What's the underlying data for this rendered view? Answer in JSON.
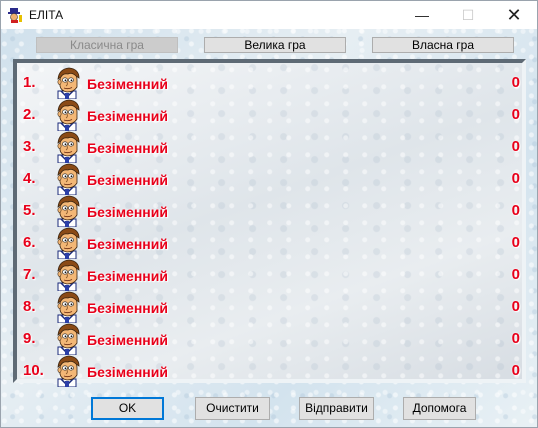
{
  "window": {
    "title": "ЕЛІТА",
    "minimize_glyph": "—",
    "maximize_glyph": "☐",
    "close_glyph": "✕"
  },
  "tabs": [
    {
      "label": "Класична гра",
      "enabled": false
    },
    {
      "label": "Велика гра",
      "enabled": true
    },
    {
      "label": "Власна гра",
      "enabled": true
    }
  ],
  "scores": [
    {
      "rank": "1.",
      "name": "Безіменний",
      "score": "0"
    },
    {
      "rank": "2.",
      "name": "Безіменний",
      "score": "0"
    },
    {
      "rank": "3.",
      "name": "Безіменний",
      "score": "0"
    },
    {
      "rank": "4.",
      "name": "Безіменний",
      "score": "0"
    },
    {
      "rank": "5.",
      "name": "Безіменний",
      "score": "0"
    },
    {
      "rank": "6.",
      "name": "Безіменний",
      "score": "0"
    },
    {
      "rank": "7.",
      "name": "Безіменний",
      "score": "0"
    },
    {
      "rank": "8.",
      "name": "Безіменний",
      "score": "0"
    },
    {
      "rank": "9.",
      "name": "Безіменний",
      "score": "0"
    },
    {
      "rank": "10.",
      "name": "Безіменний",
      "score": "0"
    }
  ],
  "buttons": {
    "ok": "OK",
    "clear": "Очистити",
    "send": "Відправити",
    "help": "Допомога"
  },
  "colors": {
    "accent_red": "#e8001a",
    "focus_blue": "#0078d7"
  }
}
